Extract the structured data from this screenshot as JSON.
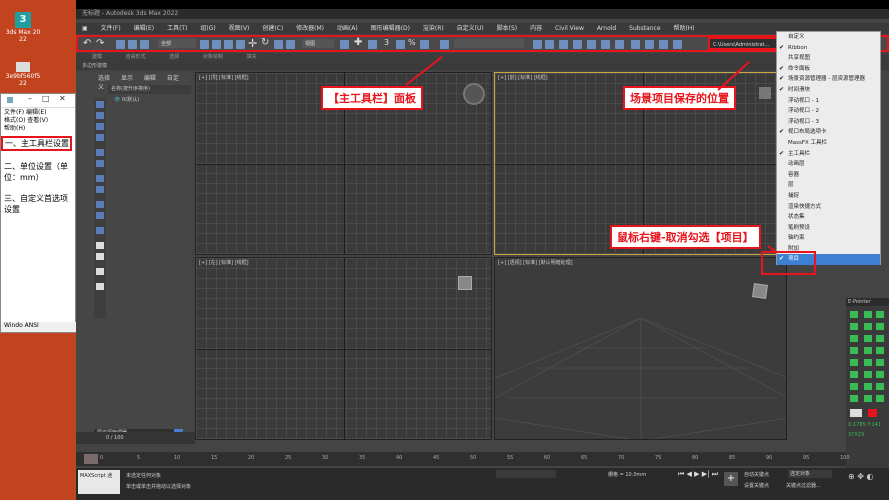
{
  "desktop": {
    "icon1_label": "3ds Max 20 22",
    "icon2_label": "3e9bf560f5 22"
  },
  "notepad": {
    "menu1": "文件(F)  编辑(E)",
    "menu2": "格式(O)  查看(V)",
    "menu3": "帮助(H)",
    "line1": "一、主工具栏设置",
    "line2": "二、单位设置（单位：mm）",
    "line3": "三、自定义首选项设置",
    "status": "Windo  ANSI"
  },
  "app": {
    "title": "无标题 - Autodesk 3ds Max 2022",
    "menus": [
      "文件(F)",
      "编辑(E)",
      "工具(T)",
      "组(G)",
      "视图(V)",
      "创建(C)",
      "修改器(M)",
      "动画(A)",
      "图形编辑器(D)",
      "渲染(R)",
      "自定义(U)",
      "脚本(S)",
      "内容",
      "Civil View",
      "Arnold",
      "Substance",
      "帮助(H)"
    ],
    "selection_dropdown": "全部",
    "view_dropdown": "视图",
    "path_field": "C:\\Users\\Administrat..."
  },
  "ribbon": {
    "tabs": [
      "建模",
      "自由形式",
      "选择",
      "对象绘制",
      "填充"
    ],
    "sub": "多边形建模"
  },
  "scene_explorer": {
    "tabs": [
      "选择",
      "显示",
      "编辑",
      "自定义"
    ],
    "header": "名称(按升序排序)",
    "item": "0(默认)",
    "footer": "层资源管理器"
  },
  "viewports": {
    "top": "[+] [顶] [标准] [线框]",
    "front": "[+] [前] [标准] [线框]",
    "left": "[+] [左] [标准] [线框]",
    "persp": "[+] [透视] [标准] [默认明暗处理]"
  },
  "annotations": {
    "toolbar": "【主工具栏】面板",
    "path": "场景项目保存的位置",
    "rightclick": "鼠标右键-取消勾选【项目】"
  },
  "context_menu": {
    "items": [
      {
        "label": "自定义",
        "checked": false,
        "selected": false
      },
      {
        "label": "Ribbon",
        "checked": true,
        "selected": false
      },
      {
        "label": "共享视图",
        "checked": false,
        "selected": false
      },
      {
        "label": "命令面板",
        "checked": true,
        "selected": false
      },
      {
        "label": "场景资源管理器 - 层资源管理器",
        "checked": true,
        "selected": false
      },
      {
        "label": "时间滑块",
        "checked": true,
        "selected": false
      },
      {
        "label": "浮动视口 - 1",
        "checked": false,
        "selected": false
      },
      {
        "label": "浮动视口 - 2",
        "checked": false,
        "selected": false
      },
      {
        "label": "浮动视口 - 3",
        "checked": false,
        "selected": false
      },
      {
        "label": "视口布局选项卡",
        "checked": true,
        "selected": false
      },
      {
        "label": "MassFX 工具栏",
        "checked": false,
        "selected": false
      },
      {
        "label": "主工具栏",
        "checked": true,
        "selected": false
      },
      {
        "label": "动画层",
        "checked": false,
        "selected": false
      },
      {
        "label": "容器",
        "checked": false,
        "selected": false
      },
      {
        "label": "层",
        "checked": false,
        "selected": false
      },
      {
        "label": "捕捉",
        "checked": false,
        "selected": false
      },
      {
        "label": "渲染快捷方式",
        "checked": false,
        "selected": false
      },
      {
        "label": "状态集",
        "checked": false,
        "selected": false
      },
      {
        "label": "笔刷预设",
        "checked": false,
        "selected": false
      },
      {
        "label": "轴约束",
        "checked": false,
        "selected": false
      },
      {
        "label": "附加",
        "checked": false,
        "selected": false
      },
      {
        "label": "项目",
        "checked": true,
        "selected": true
      }
    ]
  },
  "right_panel": {
    "title": "E-Pointer",
    "coord1": "X:1785 Y:141",
    "coord2": "37X29"
  },
  "timeline": {
    "frame": "0 / 100",
    "ticks": [
      "0",
      "5",
      "10",
      "15",
      "20",
      "25",
      "30",
      "35",
      "40",
      "45",
      "50",
      "55",
      "60",
      "65",
      "70",
      "75",
      "80",
      "85",
      "90",
      "95",
      "100"
    ]
  },
  "status": {
    "maxscript": "MAXScript 迷",
    "msg1": "未选定任何对象",
    "msg2": "单击或单击并拖动以选择对象",
    "grid": "栅格 = 10.0mm",
    "autokey": "自动关键点",
    "setkey": "设置关键点",
    "sel_obj": "选定对象",
    "keyfilter": "关键点过滤器..."
  }
}
